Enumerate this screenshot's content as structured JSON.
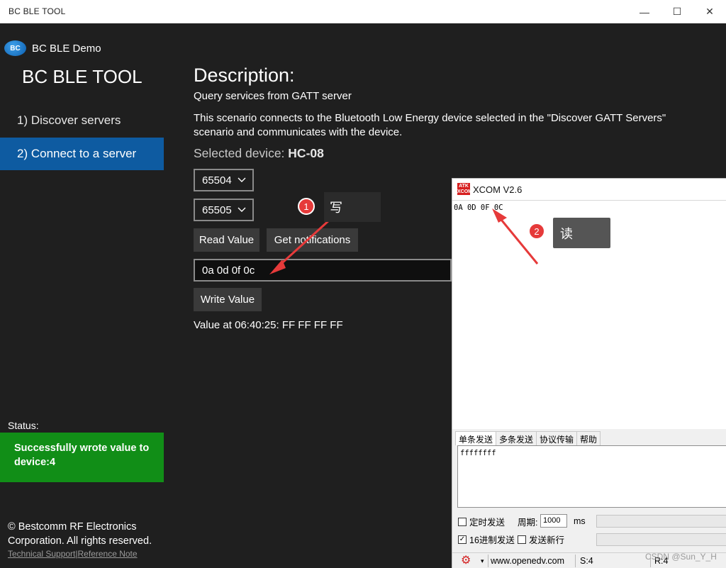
{
  "window": {
    "title": "BC BLE TOOL",
    "min": "—",
    "max": "☐",
    "close": "✕"
  },
  "app": {
    "name": "BC BLE Demo",
    "logo_text": "BC"
  },
  "sidebar": {
    "title": "BC BLE TOOL",
    "items": [
      {
        "label": "1) Discover servers",
        "selected": false
      },
      {
        "label": "2) Connect to a server",
        "selected": true
      }
    ],
    "status_label": "Status:",
    "status_message": "Successfully wrote value to device:4",
    "status_color": "#118e17",
    "copyright": "© Bestcomm RF Electronics Corporation. All rights reserved.",
    "link_support": "Technical Support",
    "link_separator": "|",
    "link_reference": "Reference Note"
  },
  "main": {
    "heading": "Description:",
    "subheading": "Query services from GATT server",
    "description": "This scenario connects to the Bluetooth Low Energy device selected in the \"Discover GATT Servers\" scenario and communicates with the device.",
    "selected_label": "Selected device:",
    "selected_device": "HC-08",
    "service_select": "65504",
    "characteristic_select": "65505",
    "read_button": "Read Value",
    "notify_button": "Get notifications",
    "write_input_value": "0a 0d 0f 0c",
    "write_button": "Write Value",
    "value_line": "Value at 06:40:25: FF FF FF FF"
  },
  "annotations": {
    "badge1": "1",
    "note1": "写",
    "badge2": "2",
    "note2": "读"
  },
  "xcom": {
    "logo_text": "ATK XCOM",
    "title": "XCOM V2.6",
    "receive_text": "0A 0D 0F 0C",
    "tabs": [
      "单条发送",
      "多条发送",
      "协议传输",
      "帮助"
    ],
    "send_text": "ffffffff",
    "timed_send_label": "定时发送",
    "period_label": "周期:",
    "period_value": "1000",
    "period_unit": "ms",
    "hex_send_label": "16进制发送",
    "hex_send_checked": "✓",
    "newline_label": "发送新行",
    "website": "www.openedv.com",
    "sent_count": "S:4",
    "recv_count": "R:4"
  },
  "watermark": "CSDN @Sun_Y_H"
}
